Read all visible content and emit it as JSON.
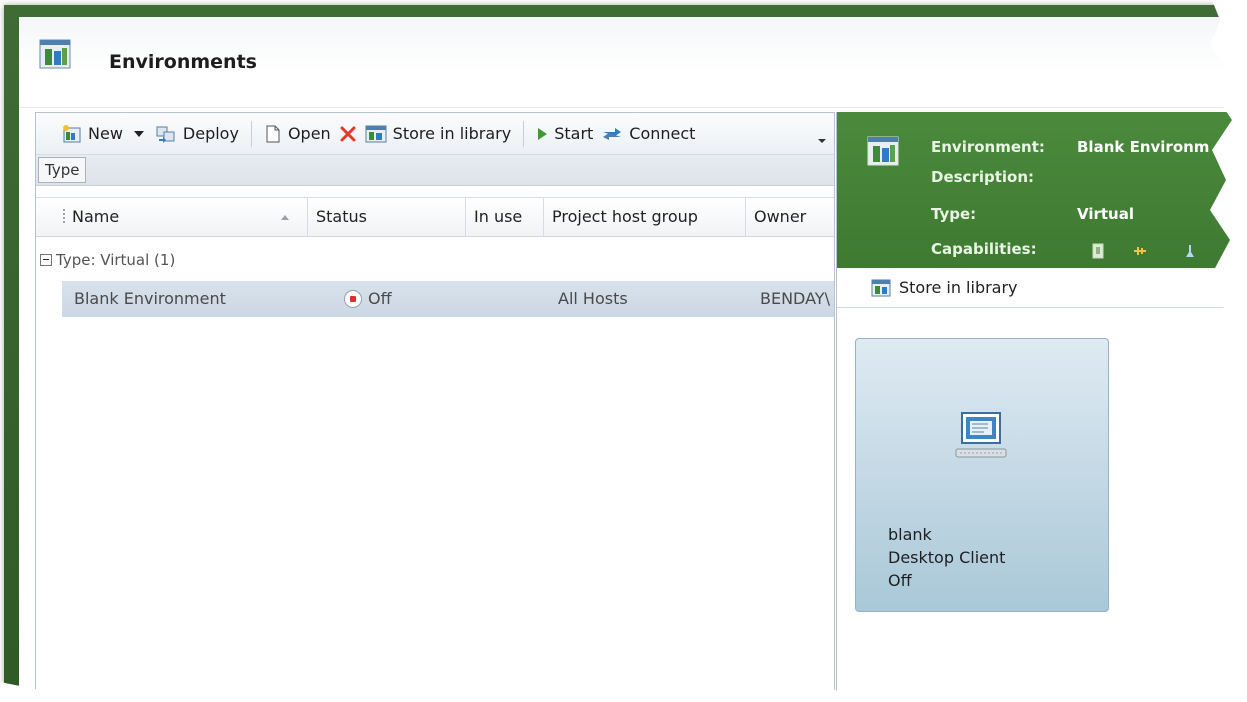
{
  "window": {
    "title": "Environments",
    "title_icon": "environment-icon"
  },
  "toolbar": {
    "new_label": "New",
    "deploy_label": "Deploy",
    "open_label": "Open",
    "store_label": "Store in library",
    "start_label": "Start",
    "connect_label": "Connect",
    "icons": [
      "new-icon",
      "dropdown-arrow-icon",
      "deploy-icon",
      "open-icon",
      "delete-icon",
      "store-library-icon",
      "start-icon",
      "connect-icon",
      "overflow-icon"
    ]
  },
  "groupby": {
    "chip": "Type"
  },
  "grid": {
    "columns": [
      "Name",
      "Status",
      "In use",
      "Project host group",
      "Owner"
    ],
    "group_label": "Type: Virtual (1)",
    "rows": [
      {
        "name": "Blank Environment",
        "status": "Off",
        "in_use": "",
        "host_group": "All Hosts",
        "owner": "BENDAY\\"
      }
    ]
  },
  "details": {
    "environment_label": "Environment:",
    "environment_value": "Blank Environm",
    "description_label": "Description:",
    "description_value": "",
    "type_label": "Type:",
    "type_value": "Virtual",
    "capabilities_label": "Capabilities:",
    "capability_icons": [
      "capability-agent-icon",
      "capability-network-icon",
      "capability-test-icon"
    ],
    "store_link": "Store in library"
  },
  "vm_tile": {
    "name": "blank",
    "role": "Desktop Client",
    "state": "Off",
    "icon": "virtual-machine-icon"
  },
  "colors": {
    "frame_green": "#2f5a26",
    "details_green": "#4b8a3d",
    "selection_blue": "#cbd7e3",
    "stop_red": "#d9302b",
    "tile_blue": "#a9c8d8"
  }
}
